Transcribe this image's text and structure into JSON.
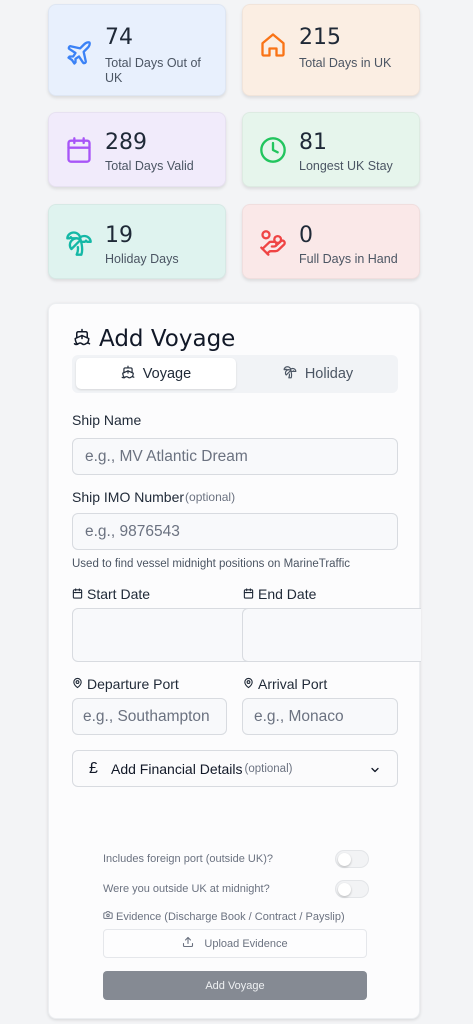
{
  "stats": [
    {
      "value": "74",
      "label": "Total Days Out of UK",
      "icon": "plane-icon",
      "color": "#3b82f6",
      "bg": "#e8f0fd"
    },
    {
      "value": "215",
      "label": "Total Days in UK",
      "icon": "home-icon",
      "color": "#f97316",
      "bg": "#fbeee3"
    },
    {
      "value": "289",
      "label": "Total Days Valid",
      "icon": "calendar-icon",
      "color": "#a855f7",
      "bg": "#f1ebfb"
    },
    {
      "value": "81",
      "label": "Longest UK Stay",
      "icon": "clock-icon",
      "color": "#22c55e",
      "bg": "#e6f5ec"
    },
    {
      "value": "19",
      "label": "Holiday Days",
      "icon": "palm-tree-icon",
      "color": "#14b8a6",
      "bg": "#dff3ef"
    },
    {
      "value": "0",
      "label": "Full Days in Hand",
      "icon": "hand-coins-icon",
      "color": "#ef4444",
      "bg": "#fae8e8"
    }
  ],
  "form": {
    "title": "Add Voyage",
    "tabs": {
      "voyage": "Voyage",
      "holiday": "Holiday"
    },
    "ship_name": {
      "label": "Ship Name",
      "placeholder": "e.g., MV Atlantic Dream",
      "value": ""
    },
    "imo": {
      "label": "Ship IMO Number",
      "optional": "(optional)",
      "placeholder": "e.g., 9876543",
      "value": "",
      "help": "Used to find vessel midnight positions on MarineTraffic"
    },
    "start_date": {
      "label": "Start Date",
      "value": ""
    },
    "end_date": {
      "label": "End Date",
      "value": ""
    },
    "departure": {
      "label": "Departure Port",
      "placeholder": "e.g., Southampton",
      "value": ""
    },
    "arrival": {
      "label": "Arrival Port",
      "placeholder": "e.g., Monaco",
      "value": ""
    },
    "financial": {
      "currency_symbol": "£",
      "label": "Add Financial Details",
      "optional": "(optional)"
    },
    "toggles": [
      {
        "label": "Includes foreign port (outside UK)?",
        "checked": false
      },
      {
        "label": "Were you outside UK at midnight?",
        "checked": false
      }
    ],
    "evidence": {
      "label": "Evidence (Discharge Book / Contract / Payslip)",
      "upload_label": "Upload Evidence"
    },
    "submit_label": "Add Voyage"
  }
}
